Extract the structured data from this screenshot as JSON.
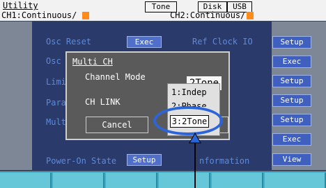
{
  "topbar": {
    "title": "Utility",
    "ch1": "CH1:Continuous/",
    "ch2": "CH2:Continuous/",
    "tab_tone": "Tone",
    "tab_disk": "Disk",
    "tab_usb": "USB"
  },
  "menu": {
    "osc_reset": "Osc Reset",
    "exec": "Exec",
    "osc": "Osc",
    "limit": "Limi",
    "param": "Para",
    "multi": "Mult",
    "power_on_state": "Power-On State",
    "setup": "Setup",
    "ref_clock": "Ref Clock IO",
    "information": "nformation"
  },
  "right_buttons": [
    "Setup",
    "Exec",
    "Setup",
    "Setup",
    "Setup",
    "Exec",
    "View"
  ],
  "dialog": {
    "title": "Multi CH",
    "channel_mode_label": "Channel Mode",
    "channel_mode_value": "2Tone",
    "ch_link_label": "CH LINK",
    "cancel": "Cancel"
  },
  "dropdown": {
    "options": [
      "1:Indep",
      "2:Phase",
      "3:2Tone"
    ],
    "selected": "3:2Tone"
  },
  "colors": {
    "accent_orange": "#ff8c1a",
    "highlight_blue": "#2b65d9",
    "softkey_cyan": "#66c7d9"
  }
}
